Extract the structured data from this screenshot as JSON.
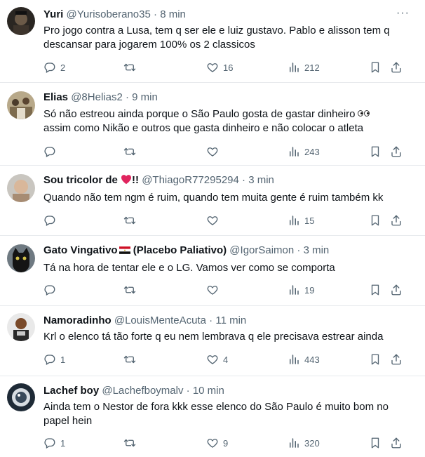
{
  "tweets": [
    {
      "name": "Yuri",
      "handle": "@Yurisoberano35",
      "dot": "·",
      "time": "8 min",
      "more": "···",
      "text": "Pro jogo contra a Lusa, tem q ser ele e luiz gustavo. Pablo e alisson tem q descansar para jogarem 100% os 2 classicos",
      "replies": "2",
      "retweets": "",
      "likes": "16",
      "views": "212"
    },
    {
      "name": "Elias",
      "handle": "@8Helias2",
      "dot": "·",
      "time": "9 min",
      "more": "···",
      "text_a": "Só não estreou ainda porque o São Paulo gosta de gastar dinheiro",
      "text_b": "assim como Nikão e outros que gasta dinheiro e não colocar o atleta",
      "emoji": "eyes",
      "replies": "",
      "retweets": "",
      "likes": "",
      "views": "243"
    },
    {
      "name": "Sou tricolor de",
      "name_suffix": "!!",
      "emoji": "red-heart",
      "handle": "@ThiagoR77295294",
      "dot": "·",
      "time": "3 min",
      "more": "",
      "text": "Quando não tem ngm é ruim, quando tem muita gente é ruim também kk",
      "replies": "",
      "retweets": "",
      "likes": "",
      "views": "15"
    },
    {
      "name": "Gato Vingativo",
      "name_suffix": " (Placebo Paliativo)",
      "emoji": "egypt-flag",
      "handle": "@IgorSaimon",
      "dot": "·",
      "time": "3 min",
      "more": "",
      "text": "Tá na hora de tentar ele e o LG. Vamos ver como se comporta",
      "replies": "",
      "retweets": "",
      "likes": "",
      "views": "19"
    },
    {
      "name": "Namoradinho",
      "handle": "@LouisMenteAcuta",
      "dot": "·",
      "time": "11 min",
      "more": "",
      "text": "Krl o elenco tá tão forte q eu nem lembrava q ele precisava estrear ainda",
      "replies": "1",
      "retweets": "",
      "likes": "4",
      "views": "443"
    },
    {
      "name": "Lachef boy",
      "handle": "@Lachefboymalv",
      "dot": "·",
      "time": "10 min",
      "more": "",
      "text": "Ainda tem o Nestor de fora kkk esse elenco do São Paulo é muito bom no papel hein",
      "replies": "1",
      "retweets": "",
      "likes": "9",
      "views": "320"
    }
  ],
  "colors": {
    "text": "#0f1419",
    "secondary": "#536471",
    "divider": "#e7eaed",
    "heart": "#e0245e"
  },
  "icons": [
    "reply-icon",
    "retweet-icon",
    "like-icon",
    "views-icon",
    "bookmark-icon",
    "share-icon",
    "more-icon"
  ]
}
